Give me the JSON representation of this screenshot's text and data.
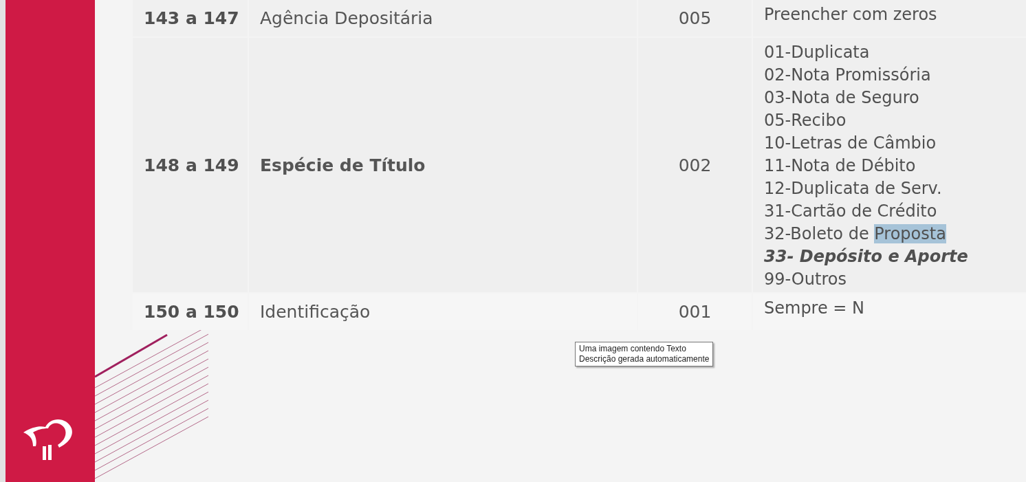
{
  "table": {
    "rows": [
      {
        "position": "143 a 147",
        "field": "Agência Depositária",
        "emphasis": false,
        "size": "005",
        "notes": [
          {
            "parts": [
              {
                "text": "Preencher com zeros",
                "selected": false
              }
            ],
            "emphasis": false
          }
        ]
      },
      {
        "position": "148 a 149",
        "field": "Espécie de Título",
        "emphasis": true,
        "size": "002",
        "notes": [
          {
            "parts": [
              {
                "text": "01-Duplicata",
                "selected": false
              }
            ],
            "emphasis": false
          },
          {
            "parts": [
              {
                "text": "02-Nota Promissória",
                "selected": false
              }
            ],
            "emphasis": false
          },
          {
            "parts": [
              {
                "text": "03-Nota de Seguro",
                "selected": false
              }
            ],
            "emphasis": false
          },
          {
            "parts": [
              {
                "text": "05-Recibo",
                "selected": false
              }
            ],
            "emphasis": false
          },
          {
            "parts": [
              {
                "text": "10-Letras de Câmbio",
                "selected": false
              }
            ],
            "emphasis": false
          },
          {
            "parts": [
              {
                "text": "11-Nota de Débito",
                "selected": false
              }
            ],
            "emphasis": false
          },
          {
            "parts": [
              {
                "text": "12-Duplicata de Serv.",
                "selected": false
              }
            ],
            "emphasis": false
          },
          {
            "parts": [
              {
                "text": "31-Cartão de Crédito",
                "selected": false
              }
            ],
            "emphasis": false
          },
          {
            "parts": [
              {
                "text": "32-Boleto de ",
                "selected": false
              },
              {
                "text": "Proposta",
                "selected": true
              }
            ],
            "emphasis": false
          },
          {
            "parts": [
              {
                "text": "33- Depósito e Aporte",
                "selected": false
              }
            ],
            "emphasis": true
          },
          {
            "parts": [
              {
                "text": "99-Outros",
                "selected": false
              }
            ],
            "emphasis": false
          }
        ]
      },
      {
        "position": "150 a 150",
        "field": "Identificação",
        "emphasis": false,
        "size": "001",
        "notes": [
          {
            "parts": [
              {
                "text": "Sempre = N",
                "selected": false
              }
            ],
            "emphasis": false
          }
        ]
      }
    ]
  },
  "tooltip": {
    "lines": [
      "Uma imagem contendo Texto",
      "Descrição gerada automaticamente"
    ]
  }
}
